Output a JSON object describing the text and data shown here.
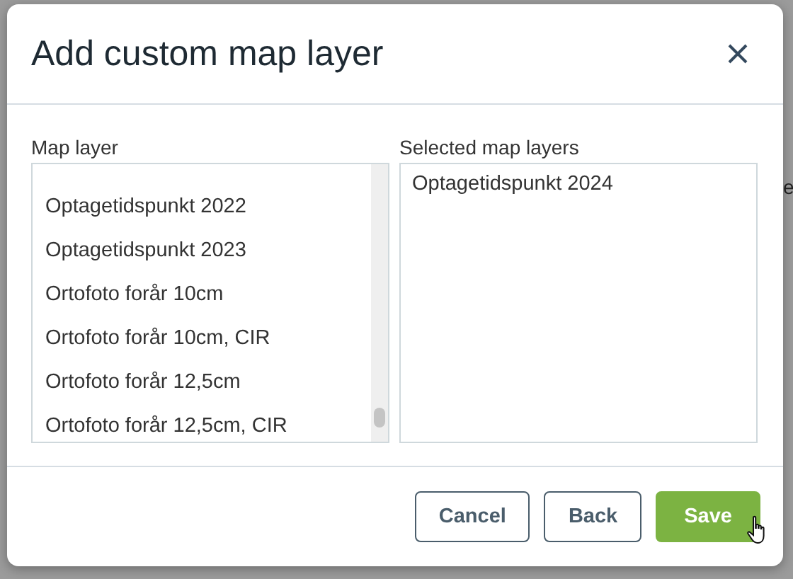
{
  "background": {
    "cell_text": "e"
  },
  "dialog": {
    "title": "Add custom map layer",
    "available": {
      "label": "Map layer",
      "items": [
        {
          "label": "Optagetidspunkt 2022"
        },
        {
          "label": "Optagetidspunkt 2023"
        },
        {
          "label": "Ortofoto forår 10cm"
        },
        {
          "label": "Ortofoto forår 10cm, CIR"
        },
        {
          "label": "Ortofoto forår 12,5cm"
        },
        {
          "label": "Ortofoto forår 12,5cm, CIR"
        }
      ]
    },
    "selected": {
      "label": "Selected map layers",
      "items": [
        {
          "label": "Optagetidspunkt 2024"
        }
      ]
    },
    "buttons": [
      {
        "label": "Cancel",
        "kind": "outline"
      },
      {
        "label": "Back",
        "kind": "outline"
      },
      {
        "label": "Save",
        "kind": "primary"
      }
    ]
  }
}
